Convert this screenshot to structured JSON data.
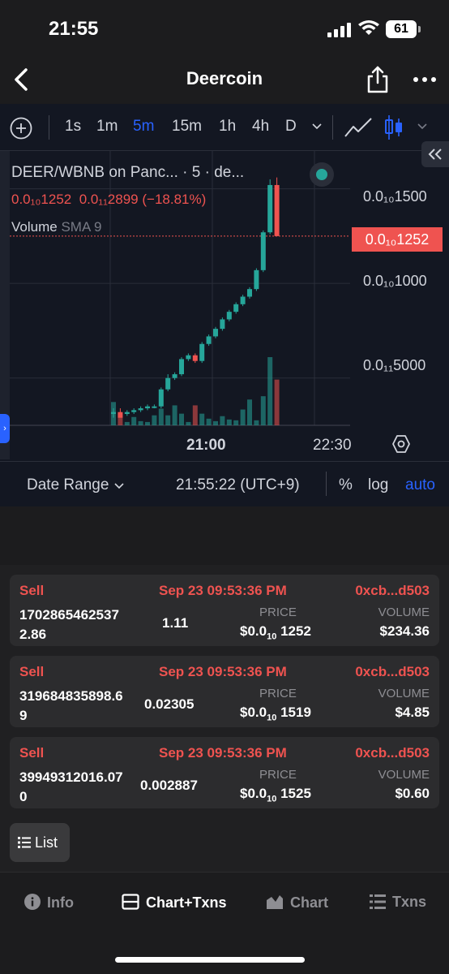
{
  "status": {
    "time": "21:55",
    "battery": "61"
  },
  "nav": {
    "title": "Deercoin"
  },
  "toolbar": {
    "intervals": [
      "1s",
      "1m",
      "5m",
      "15m",
      "1h",
      "4h",
      "D"
    ],
    "active_interval": "5m"
  },
  "chart": {
    "symbol": "DEER/WBNB on Panc... · 5 · de...",
    "open_value": "0.0₁₀1252",
    "change_value": "0.0₁₁2899 (−18.81%)",
    "volume_label": "Volume",
    "volume_sma": "SMA 9",
    "price_axis": [
      "0.0₁₀1500",
      "0.0₁₀1000",
      "0.0₁₁5000"
    ],
    "current_price_tag": "0.0₁₀1252",
    "time_axis": [
      "21:00",
      "22:30"
    ]
  },
  "chart_data": {
    "type": "candlestick",
    "title": "DEER/WBNB on Panc... · 5 · de...",
    "interval": "5m",
    "y_range": [
      2.5e-11,
      1.7e-10
    ],
    "candles": [
      {
        "o": 3.1e-11,
        "h": 3.4e-11,
        "l": 2.9e-11,
        "c": 3.2e-11
      },
      {
        "o": 3.2e-11,
        "h": 3.4e-11,
        "l": 3e-11,
        "c": 2.9e-11
      },
      {
        "o": 3.1e-11,
        "h": 3.3e-11,
        "l": 3e-11,
        "c": 3.2e-11
      },
      {
        "o": 3.2e-11,
        "h": 3.4e-11,
        "l": 3.1e-11,
        "c": 3.3e-11
      },
      {
        "o": 3.3e-11,
        "h": 3.5e-11,
        "l": 3.2e-11,
        "c": 3.4e-11
      },
      {
        "o": 3.4e-11,
        "h": 3.6e-11,
        "l": 3.3e-11,
        "c": 3.5e-11
      },
      {
        "o": 3.5e-11,
        "h": 3.6e-11,
        "l": 3.4e-11,
        "c": 3.5e-11
      },
      {
        "o": 3.5e-11,
        "h": 4.5e-11,
        "l": 3.4e-11,
        "c": 4.4e-11
      },
      {
        "o": 4.4e-11,
        "h": 5.2e-11,
        "l": 4.3e-11,
        "c": 5e-11
      },
      {
        "o": 5e-11,
        "h": 5.3e-11,
        "l": 4.9e-11,
        "c": 5.2e-11
      },
      {
        "o": 5.2e-11,
        "h": 6.1e-11,
        "l": 5.1e-11,
        "c": 6e-11
      },
      {
        "o": 6e-11,
        "h": 6.3e-11,
        "l": 5.9e-11,
        "c": 6.2e-11
      },
      {
        "o": 6.2e-11,
        "h": 6.3e-11,
        "l": 5.8e-11,
        "c": 5.9e-11
      },
      {
        "o": 5.9e-11,
        "h": 6.9e-11,
        "l": 5.8e-11,
        "c": 6.8e-11
      },
      {
        "o": 6.8e-11,
        "h": 7.3e-11,
        "l": 6.7e-11,
        "c": 7.2e-11
      },
      {
        "o": 7.2e-11,
        "h": 7.7e-11,
        "l": 7.1e-11,
        "c": 7.6e-11
      },
      {
        "o": 7.6e-11,
        "h": 8.2e-11,
        "l": 7.5e-11,
        "c": 8.1e-11
      },
      {
        "o": 8.1e-11,
        "h": 8.6e-11,
        "l": 8e-11,
        "c": 8.5e-11
      },
      {
        "o": 8.5e-11,
        "h": 9e-11,
        "l": 8.4e-11,
        "c": 8.9e-11
      },
      {
        "o": 8.9e-11,
        "h": 9.4e-11,
        "l": 8.8e-11,
        "c": 9.3e-11
      },
      {
        "o": 9.3e-11,
        "h": 9.8e-11,
        "l": 9.2e-11,
        "c": 9.7e-11
      },
      {
        "o": 9.7e-11,
        "h": 1.08e-10,
        "l": 9.6e-11,
        "c": 1.07e-10
      },
      {
        "o": 1.07e-10,
        "h": 1.28e-10,
        "l": 1.06e-10,
        "c": 1.27e-10
      },
      {
        "o": 1.27e-10,
        "h": 1.55e-10,
        "l": 1.26e-10,
        "c": 1.52e-10
      },
      {
        "o": 1.52e-10,
        "h": 1.56e-10,
        "l": 1.25e-10,
        "c": 1.25e-10
      }
    ],
    "volume": [
      28,
      14,
      4,
      10,
      5,
      4,
      12,
      20,
      12,
      24,
      14,
      4,
      24,
      14,
      8,
      5,
      11,
      7,
      6,
      19,
      31,
      6,
      35,
      82,
      55
    ]
  },
  "bottom_bar": {
    "date_range": "Date Range",
    "clock": "21:55:22 (UTC+9)",
    "percent": "%",
    "log": "log",
    "auto": "auto"
  },
  "txns": [
    {
      "type": "Sell",
      "date": "Sep 23 09:53:36 PM",
      "address": "0xcb...d503",
      "amount": "17028654625372.86",
      "qty": "1.11",
      "price_label": "PRICE",
      "price_prefix": "$0.0",
      "price_sub": "10",
      "price_tail": "1252",
      "volume_label": "VOLUME",
      "volume": "$234.36"
    },
    {
      "type": "Sell",
      "date": "Sep 23 09:53:36 PM",
      "address": "0xcb...d503",
      "amount": "319684835898.69",
      "qty": "0.02305",
      "price_label": "PRICE",
      "price_prefix": "$0.0",
      "price_sub": "10",
      "price_tail": "1519",
      "volume_label": "VOLUME",
      "volume": "$4.85"
    },
    {
      "type": "Sell",
      "date": "Sep 23 09:53:36 PM",
      "address": "0xcb...d503",
      "amount": "39949312016.070",
      "qty": "0.002887",
      "price_label": "PRICE",
      "price_prefix": "$0.0",
      "price_sub": "10",
      "price_tail": "1525",
      "volume_label": "VOLUME",
      "volume": "$0.60"
    }
  ],
  "list_button": "List",
  "tabs": [
    {
      "label": "Info",
      "icon": "info-icon"
    },
    {
      "label": "Chart+Txns",
      "icon": "split-view-icon"
    },
    {
      "label": "Chart",
      "icon": "area-chart-icon"
    },
    {
      "label": "Txns",
      "icon": "list-icon"
    }
  ],
  "active_tab": "Chart+Txns",
  "colors": {
    "up": "#26a69a",
    "down": "#ef5350",
    "accent": "#2962ff"
  }
}
